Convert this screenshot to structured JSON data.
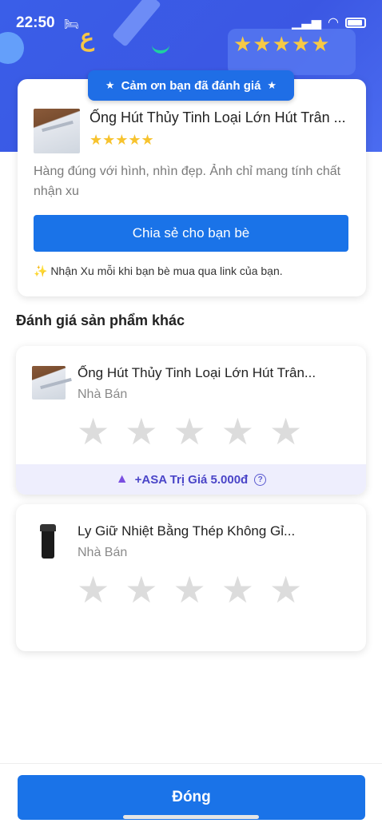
{
  "status_bar": {
    "time": "22:50",
    "bed_icon": "bed-icon",
    "signal_icon": "signal-icon",
    "wifi_icon": "wifi-icon",
    "battery_icon": "battery-icon"
  },
  "hero": {
    "decor_letter": "ع",
    "decor_stars": "★★★★★"
  },
  "thanks_card": {
    "ribbon_label": "Cảm ơn bạn đã đánh giá",
    "ribbon_star": "★",
    "product_title": "Ống Hút Thủy Tinh Loại Lớn Hút Trân ...",
    "rating_stars": "★★★★★",
    "rating_value": 5,
    "review_text": "Hàng đúng với hình, nhìn đẹp. Ảnh chỉ mang tính chất nhận xu",
    "share_button": "Chia sẻ cho bạn bè",
    "note": "✨ Nhận Xu mỗi khi bạn bè mua qua link của bạn."
  },
  "other_reviews": {
    "section_title": "Đánh giá sản phẩm khác",
    "star_glyph": "★",
    "items": [
      {
        "title": "Ống Hút Thủy Tinh Loại Lớn Hút Trân...",
        "seller": "Nhà Bán",
        "reward": {
          "icon": "asa-logo-icon",
          "text": "+ASA Trị Giá 5.000đ",
          "help": "?"
        }
      },
      {
        "title": "Ly Giữ Nhiệt Bằng Thép Không Gỉ...",
        "seller": "Nhà Bán"
      }
    ]
  },
  "footer": {
    "close_button": "Đóng"
  },
  "colors": {
    "brand_blue": "#1a73e8",
    "hero_blue": "#3a5ee8",
    "star_gold": "#f7c32e",
    "star_empty": "#dcdcdc",
    "reward_bg": "#eeeefd",
    "reward_text": "#4a45c8"
  }
}
